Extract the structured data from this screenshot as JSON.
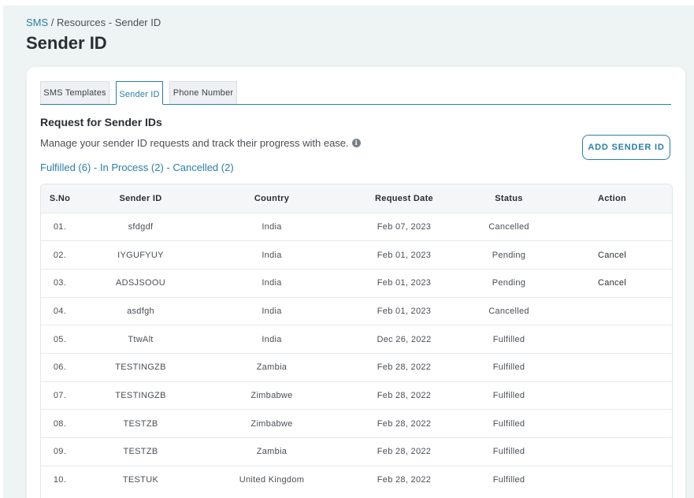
{
  "breadcrumb": {
    "root": "SMS",
    "separator": " / ",
    "rest": "Resources - Sender ID"
  },
  "page_title": "Sender ID",
  "tabs": [
    {
      "label": "SMS Templates",
      "active": false
    },
    {
      "label": "Sender ID",
      "active": true
    },
    {
      "label": "Phone Number",
      "active": false
    }
  ],
  "section": {
    "title": "Request for Sender IDs",
    "description": "Manage your sender ID requests and track their progress with ease.",
    "info_icon": "info-icon"
  },
  "status_summary": {
    "fulfilled": "Fulfilled (6)",
    "in_process": "In Process (2)",
    "cancelled": "Cancelled (2)",
    "separator": " - "
  },
  "add_button_label": "ADD SENDER ID",
  "table": {
    "headers": [
      "S.No",
      "Sender ID",
      "Country",
      "Request Date",
      "Status",
      "Action"
    ],
    "rows": [
      {
        "sno": "01.",
        "sender_id": "sfdgdf",
        "country": "India",
        "date": "Feb 07, 2023",
        "status": "Cancelled",
        "action": ""
      },
      {
        "sno": "02.",
        "sender_id": "IYGUFYUY",
        "country": "India",
        "date": "Feb 01, 2023",
        "status": "Pending",
        "action": "Cancel"
      },
      {
        "sno": "03.",
        "sender_id": "ADSJSOOU",
        "country": "India",
        "date": "Feb 01, 2023",
        "status": "Pending",
        "action": "Cancel"
      },
      {
        "sno": "04.",
        "sender_id": "asdfgh",
        "country": "India",
        "date": "Feb 01, 2023",
        "status": "Cancelled",
        "action": ""
      },
      {
        "sno": "05.",
        "sender_id": "TtwAlt",
        "country": "India",
        "date": "Dec 26, 2022",
        "status": "Fulfilled",
        "action": ""
      },
      {
        "sno": "06.",
        "sender_id": "TESTINGZB",
        "country": "Zambia",
        "date": "Feb 28, 2022",
        "status": "Fulfilled",
        "action": ""
      },
      {
        "sno": "07.",
        "sender_id": "TESTINGZB",
        "country": "Zimbabwe",
        "date": "Feb 28, 2022",
        "status": "Fulfilled",
        "action": ""
      },
      {
        "sno": "08.",
        "sender_id": "TESTZB",
        "country": "Zimbabwe",
        "date": "Feb 28, 2022",
        "status": "Fulfilled",
        "action": ""
      },
      {
        "sno": "09.",
        "sender_id": "TESTZB",
        "country": "Zambia",
        "date": "Feb 28, 2022",
        "status": "Fulfilled",
        "action": ""
      },
      {
        "sno": "10.",
        "sender_id": "TESTUK",
        "country": "United Kingdom",
        "date": "Feb 28, 2022",
        "status": "Fulfilled",
        "action": ""
      }
    ]
  },
  "colors": {
    "accent": "#2a7fa6",
    "page_background": "#eef3f3"
  }
}
